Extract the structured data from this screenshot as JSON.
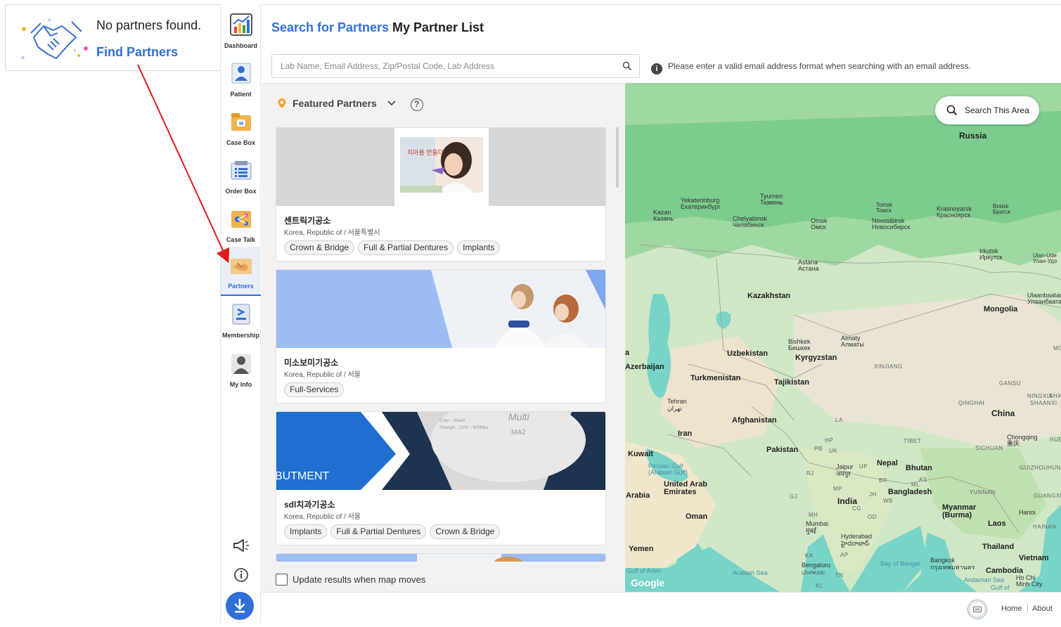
{
  "popup": {
    "message": "No partners found.",
    "link_label": "Find Partners"
  },
  "sidebar": {
    "items": [
      {
        "label": "Dashboard",
        "icon": "dashboard-chart-icon"
      },
      {
        "label": "Patient",
        "icon": "patient-icon"
      },
      {
        "label": "Case Box",
        "icon": "case-box-icon"
      },
      {
        "label": "Order Box",
        "icon": "order-box-icon"
      },
      {
        "label": "Case Talk",
        "icon": "case-talk-icon"
      },
      {
        "label": "Partners",
        "icon": "partners-handshake-icon",
        "active": true
      },
      {
        "label": "Membership",
        "icon": "membership-icon"
      },
      {
        "label": "My Info",
        "icon": "my-info-icon"
      }
    ],
    "bottom_icons": [
      "megaphone-icon",
      "info-icon",
      "download-icon"
    ]
  },
  "header": {
    "tab_search": "Search for Partners",
    "tab_list": "My Partner List"
  },
  "search": {
    "placeholder": "Lab Name, Email Address, Zip/Postal Code, Lab Address",
    "value": "",
    "note": "Please enter a valid email address format when searching with an email address."
  },
  "listing": {
    "featured_label": "Featured Partners",
    "partners": [
      {
        "name": "센트릭기공소",
        "location": "Korea, Republic of / 서울특별시",
        "tags": [
          "Crown & Bridge",
          "Full & Partial Dentures",
          "Implants"
        ]
      },
      {
        "name": "미소보미기공소",
        "location": "Korea, Republic of / 서울",
        "tags": [
          "Full-Services"
        ]
      },
      {
        "name": "sdl치과기공소",
        "location": "Korea, Republic of / 서울",
        "tags": [
          "Implants",
          "Full & Partial Dentures",
          "Crown & Bridge"
        ]
      }
    ],
    "banner_texts": {
      "card1_korean": "치아를 만들다",
      "card3_main": "BUTMENT",
      "card3_brand": "Multi",
      "card3_code": "MA2",
      "card3_shade": "Color : Shade",
      "card3_strength": "Strength : 1200 ~ 600Mpa"
    },
    "update_checkbox_label": "Update results when map moves",
    "update_checked": false
  },
  "map": {
    "search_area_label": "Search This Area",
    "attribution": "Google",
    "labels": {
      "russia": "Russia",
      "kazakhstan": "Kazakhstan",
      "mongolia": "Mongolia",
      "china": "China",
      "india": "India",
      "iran": "Iran",
      "afghanistan": "Afghanistan",
      "pakistan": "Pakistan",
      "turkmenistan": "Turkmenistan",
      "uzbekistan": "Uzbekistan",
      "kyrgyzstan": "Kyrgyzstan",
      "tajikistan": "Tajikistan",
      "azerbaijan": "Azerbaijan",
      "kuwait": "Kuwait",
      "arabia": "Arabia",
      "uae": "United Arab Emirates",
      "oman": "Oman",
      "yemen": "Yemen",
      "nepal": "Nepal",
      "bhutan": "Bhutan",
      "bangladesh": "Bangladesh",
      "myanmar": "Myanmar (Burma)",
      "laos": "Laos",
      "thailand": "Thailand",
      "vietnam": "Vietnam",
      "cambodia": "Cambodia",
      "yekaterinburg": "Yekaterinburg\nЕкатеринбург",
      "tyumen": "Tyumen\nТюмень",
      "kazan": "Kazan\nКазань",
      "chelyabinsk": "Chelyabinsk\nЧелябинск",
      "omsk": "Omsk\nОмск",
      "tomsk": "Tomsk\nТомск",
      "novosibirsk": "Novosibirsk\nНовосибирск",
      "krasnoyarsk": "Krasnoyarsk\nКрасноярск",
      "bratsk": "Bratsk\nБратск",
      "irkutsk": "Irkutsk\nИркутск",
      "ulan_ude": "Ulan-Ude\nУлан-Удэ",
      "ulaanbaatar": "Ulaanbaatar\nУлаанбаатар",
      "astana": "Astana\nАстана",
      "bishkek": "Bishkek\nБишкек",
      "almaty": "Almaty\nАлматы",
      "tehran": "Tehran\nتهران",
      "xinjiang": "XINJIANG",
      "qinghai": "QINGHAI",
      "gansu": "GANSU",
      "ningxia": "NINGXIA",
      "shaanxi": "SHAANXI",
      "tibet": "TIBET",
      "sichuan": "SICHUAN",
      "yunnan": "YUNNAN",
      "guizhou": "GUIZHOU",
      "hubei": "HUB",
      "hunan": "HUN",
      "guangxi": "GUANGXI",
      "hainan": "HAINAN",
      "chongqing": "Chongqing\n重庆",
      "hanoi": "Hanoi",
      "jaipur": "Jaipur\nजयपुर",
      "mumbai": "Mumbai\nमुंबई",
      "hyderabad": "Hyderabad\nహైదరాబాద్",
      "bengaluru": "Bengaluru\nಬೆಂಗಳೂರು",
      "bangkok": "Bangkok\nกรุงเทพมหานคร",
      "ho_chi_minh": "Ho Chi\nMinh City",
      "persian_gulf": "Persian Gulf\n(Arabian Gulf)",
      "gulf_of_aden": "Gulf of Aden",
      "arabian_sea": "Arabian Sea",
      "bay_of_bengal": "Bay of Bengal",
      "andaman_sea": "Andaman Sea",
      "gulf_of": "Gulf of",
      "mo": "MO",
      "sha": "SHA",
      "pb": "PB",
      "uk": "UK",
      "up": "UP",
      "rj": "RJ",
      "gj": "GJ",
      "mp": "MP",
      "jh": "JH",
      "wb": "WB",
      "cg": "CG",
      "ka": "KA",
      "ap": "AP",
      "br": "BR",
      "as": "AS",
      "ml": "ML",
      "hp": "HP",
      "la": "LA",
      "mh": "MH",
      "tn": "TN",
      "kl": "KL",
      "od": "OD",
      "a_label": "a"
    }
  },
  "footer": {
    "home": "Home",
    "about": "About",
    "separator": "|"
  }
}
